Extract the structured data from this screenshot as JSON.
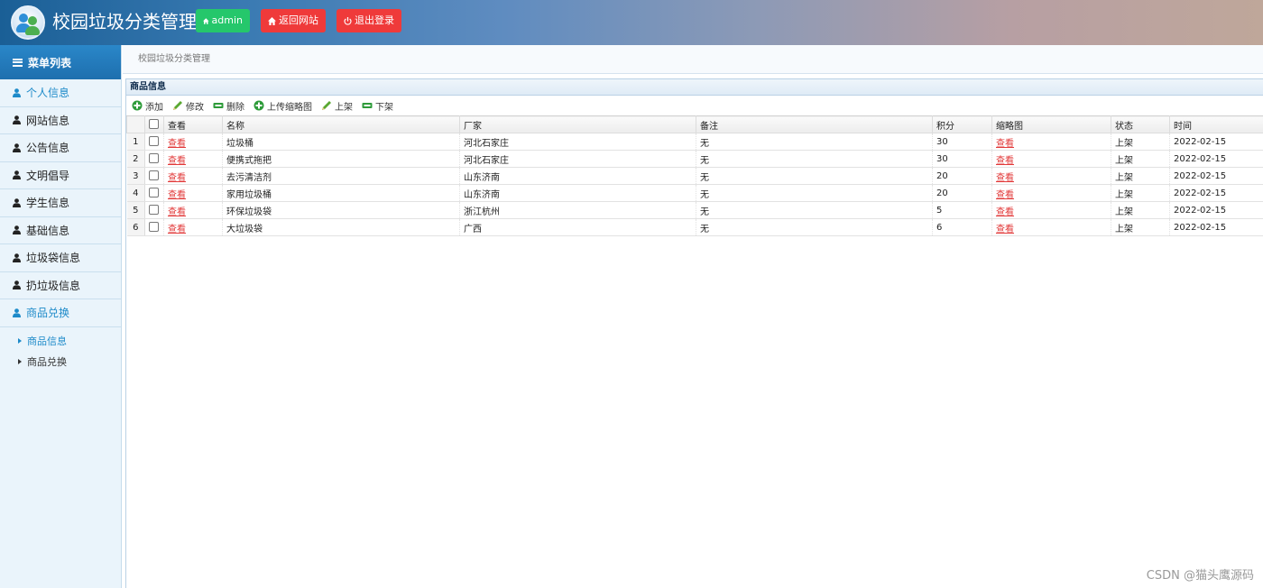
{
  "app": {
    "title": "校园垃圾分类管理",
    "buttons": {
      "admin": "admin",
      "back": "返回网站",
      "logout": "退出登录"
    }
  },
  "sidebar": {
    "heading": "菜单列表",
    "items": [
      {
        "label": "个人信息",
        "active": true
      },
      {
        "label": "网站信息",
        "active": false
      },
      {
        "label": "公告信息",
        "active": false
      },
      {
        "label": "文明倡导",
        "active": false
      },
      {
        "label": "学生信息",
        "active": false
      },
      {
        "label": "基础信息",
        "active": false
      },
      {
        "label": "垃圾袋信息",
        "active": false
      },
      {
        "label": "扔垃圾信息",
        "active": false
      },
      {
        "label": "商品兑换",
        "active": true
      }
    ],
    "subitems": [
      {
        "label": "商品信息",
        "active": true
      },
      {
        "label": "商品兑换",
        "active": false
      }
    ]
  },
  "breadcrumb": "校园垃圾分类管理",
  "panel": {
    "title": "商品信息",
    "toolbar": {
      "add": "添加",
      "edit": "修改",
      "delete": "删除",
      "upload": "上传缩略图",
      "on_shelf": "上架",
      "off_shelf": "下架"
    },
    "columns": [
      "查看",
      "名称",
      "厂家",
      "备注",
      "积分",
      "缩略图",
      "状态",
      "时间"
    ],
    "rows": [
      {
        "num": "1",
        "view": "查看",
        "name": "垃圾桶",
        "maker": "河北石家庄",
        "note": "无",
        "points": "30",
        "thumb": "查看",
        "status": "上架",
        "time": "2022-02-15"
      },
      {
        "num": "2",
        "view": "查看",
        "name": "便携式拖把",
        "maker": "河北石家庄",
        "note": "无",
        "points": "30",
        "thumb": "查看",
        "status": "上架",
        "time": "2022-02-15"
      },
      {
        "num": "3",
        "view": "查看",
        "name": "去污清洁剂",
        "maker": "山东济南",
        "note": "无",
        "points": "20",
        "thumb": "查看",
        "status": "上架",
        "time": "2022-02-15"
      },
      {
        "num": "4",
        "view": "查看",
        "name": "家用垃圾桶",
        "maker": "山东济南",
        "note": "无",
        "points": "20",
        "thumb": "查看",
        "status": "上架",
        "time": "2022-02-15"
      },
      {
        "num": "5",
        "view": "查看",
        "name": "环保垃圾袋",
        "maker": "浙江杭州",
        "note": "无",
        "points": "5",
        "thumb": "查看",
        "status": "上架",
        "time": "2022-02-15"
      },
      {
        "num": "6",
        "view": "查看",
        "name": "大垃圾袋",
        "maker": "广西",
        "note": "无",
        "points": "6",
        "thumb": "查看",
        "status": "上架",
        "time": "2022-02-15"
      }
    ]
  },
  "watermark": "CSDN @猫头鹰源码",
  "colors": {
    "accent": "#1d8ac9",
    "admin_button": "#25c76b",
    "danger_button": "#ef3a3a",
    "link": "#e23a3a"
  },
  "icons": {
    "admin": "home-icon",
    "back": "home-icon",
    "logout": "power-icon",
    "menu": "list-icon",
    "user": "user-icon"
  }
}
